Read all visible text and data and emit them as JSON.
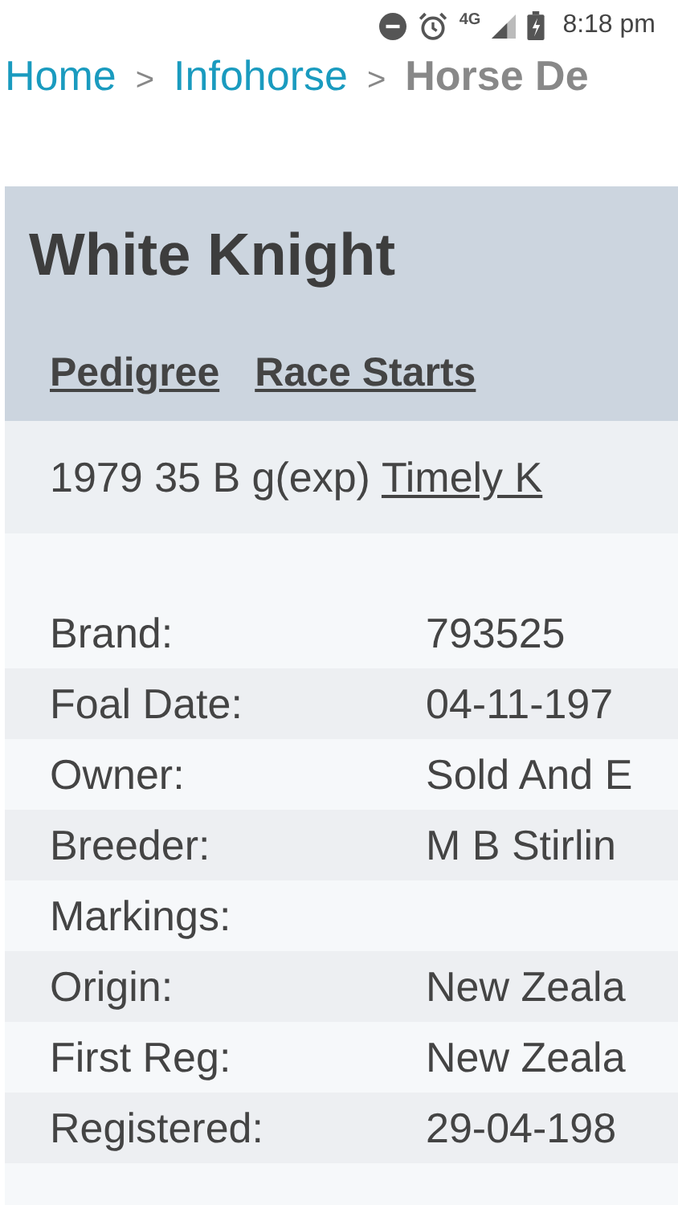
{
  "status_bar": {
    "network": "4G",
    "time": "8:18 pm"
  },
  "breadcrumb": [
    {
      "label": "Home",
      "link": true
    },
    {
      "separator": ">",
      "label": "Infohorse",
      "link": true
    },
    {
      "separator": ">",
      "label": "Horse De",
      "link": false
    }
  ],
  "horse": {
    "name": "White Knight",
    "tabs": [
      "Pedigree",
      "Race Starts"
    ],
    "summary": {
      "text": "1979 35 B g(exp)",
      "link": "Timely K"
    },
    "details": [
      {
        "label": "Brand:",
        "value": "793525"
      },
      {
        "label": "Foal Date:",
        "value": "04-11-197"
      },
      {
        "label": "Owner:",
        "value": "Sold And E"
      },
      {
        "label": "Breeder:",
        "value": "M B Stirlin"
      },
      {
        "label": "Markings:"
      },
      {
        "label": "Origin:",
        "value": "New Zeala"
      },
      {
        "label": "First Reg:",
        "value": "New Zeala"
      },
      {
        "label": "Registered:",
        "value": "29-04-198"
      }
    ]
  }
}
